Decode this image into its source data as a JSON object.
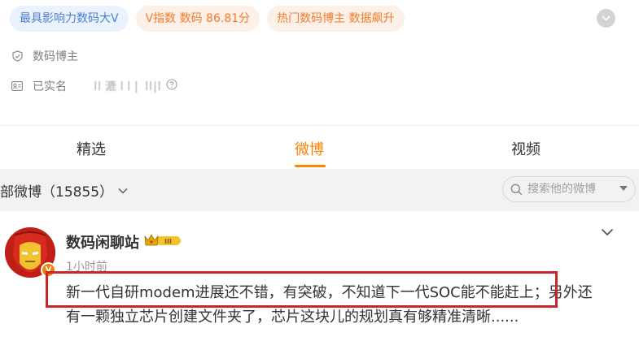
{
  "profile": {
    "badges": [
      {
        "text": "最具影响力数码大V",
        "style": "blue"
      },
      {
        "text": "V指数 数码 86.81分",
        "style": "orange"
      },
      {
        "text": "热门数码博主 数据飙升",
        "style": "orange"
      }
    ],
    "info": {
      "category": "数码博主",
      "verified_label": "已实名",
      "verified_detail": "  ll 漉 l l |  ll|l "
    }
  },
  "tabs": [
    {
      "label": "精选",
      "active": false
    },
    {
      "label": "微博",
      "active": true
    },
    {
      "label": "视频",
      "active": false
    }
  ],
  "filter": {
    "all_weibo_label": "部微博（15855）",
    "search_placeholder": "搜索他的微博"
  },
  "post": {
    "username": "数码闲聊站",
    "level_badge": "III",
    "time": "1小时前",
    "verified_mark": "V",
    "text_line1": "新一代自研modem进展还不错，有突破，不知道下一代SOC能不能赶上；另外还",
    "text_line2": "有一颗独立芯片创建文件夹了，芯片这块儿的规划真有够精准清晰......"
  },
  "colors": {
    "accent": "#ff8200",
    "badge_blue_text": "#4e7fd1",
    "badge_orange_text": "#f07c2f",
    "highlight_border": "#c9262b"
  }
}
